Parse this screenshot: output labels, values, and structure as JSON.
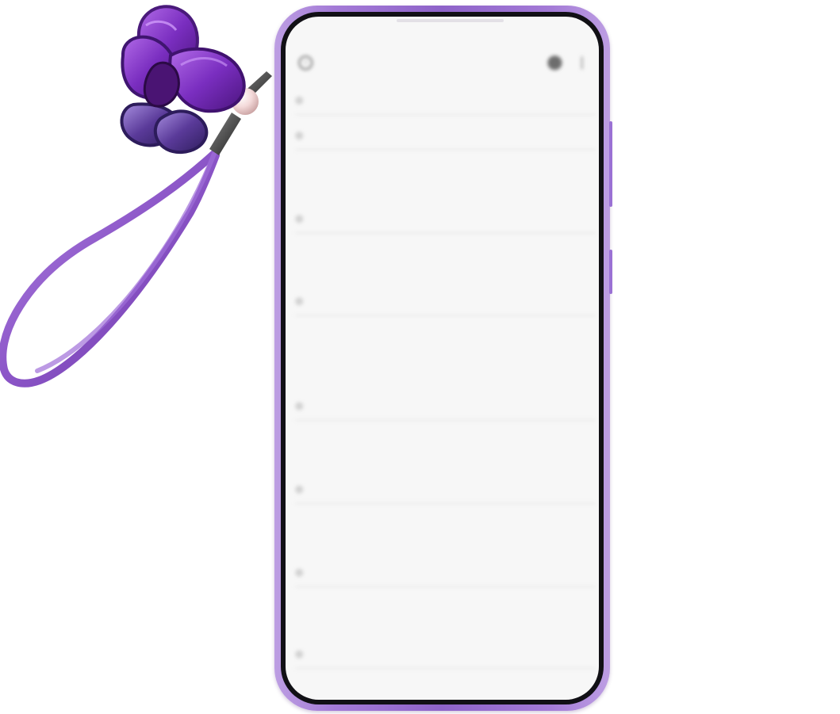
{
  "colors": {
    "phone_frame": "#9a71d4",
    "phone_frame_light": "#bd9ee3",
    "screen_background": "#f6f6f6",
    "bezel": "#111015",
    "charm_purple": "#7b3bb3",
    "strap_purple": "#8a52c1"
  },
  "decor": {
    "charm_name": "butterfly-charm-icon",
    "strap_name": "lanyard-strap-icon"
  },
  "status_bar": {
    "left": "",
    "right": ""
  },
  "top_bar": {
    "back_icon": "back-circle-icon",
    "title": "",
    "right_primary_icon": "profile-dot-icon",
    "right_secondary_icon": "menu-icon"
  },
  "feed": {
    "items": [
      {
        "title": "",
        "meta_left": "",
        "meta_mid": "",
        "meta_right": ""
      },
      {
        "title": "",
        "meta_left": "",
        "meta_mid": "",
        "meta_right": ""
      },
      {
        "title": "",
        "meta_left": "",
        "meta_mid": "",
        "meta_right": ""
      },
      {
        "title": "",
        "meta_left": "",
        "meta_mid": "",
        "meta_right": ""
      },
      {
        "title": "",
        "meta_left": "",
        "meta_mid": "",
        "meta_right": ""
      },
      {
        "title": "",
        "meta_left": "",
        "meta_mid": "",
        "meta_right": ""
      },
      {
        "title": "",
        "meta_left": "",
        "meta_mid": "",
        "meta_right": ""
      },
      {
        "title": "",
        "meta_left": "",
        "meta_mid": "",
        "meta_right": ""
      }
    ]
  }
}
